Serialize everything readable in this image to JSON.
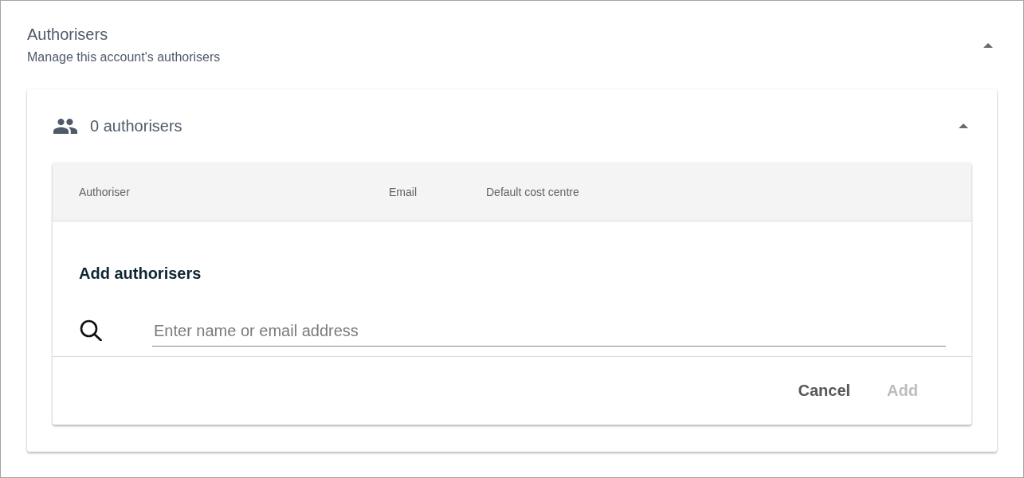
{
  "section": {
    "title": "Authorisers",
    "subtitle": "Manage this account's authorisers",
    "expanded": true
  },
  "panel": {
    "title": "0 authorisers",
    "expanded": true,
    "table": {
      "columns": [
        "Authoriser",
        "Email",
        "Default cost centre"
      ]
    },
    "add_form": {
      "heading": "Add authorisers",
      "search": {
        "placeholder": "Enter name or email address"
      },
      "buttons": [
        {
          "label": "Cancel",
          "disabled": false
        },
        {
          "label": "Add",
          "disabled": true
        }
      ]
    }
  }
}
